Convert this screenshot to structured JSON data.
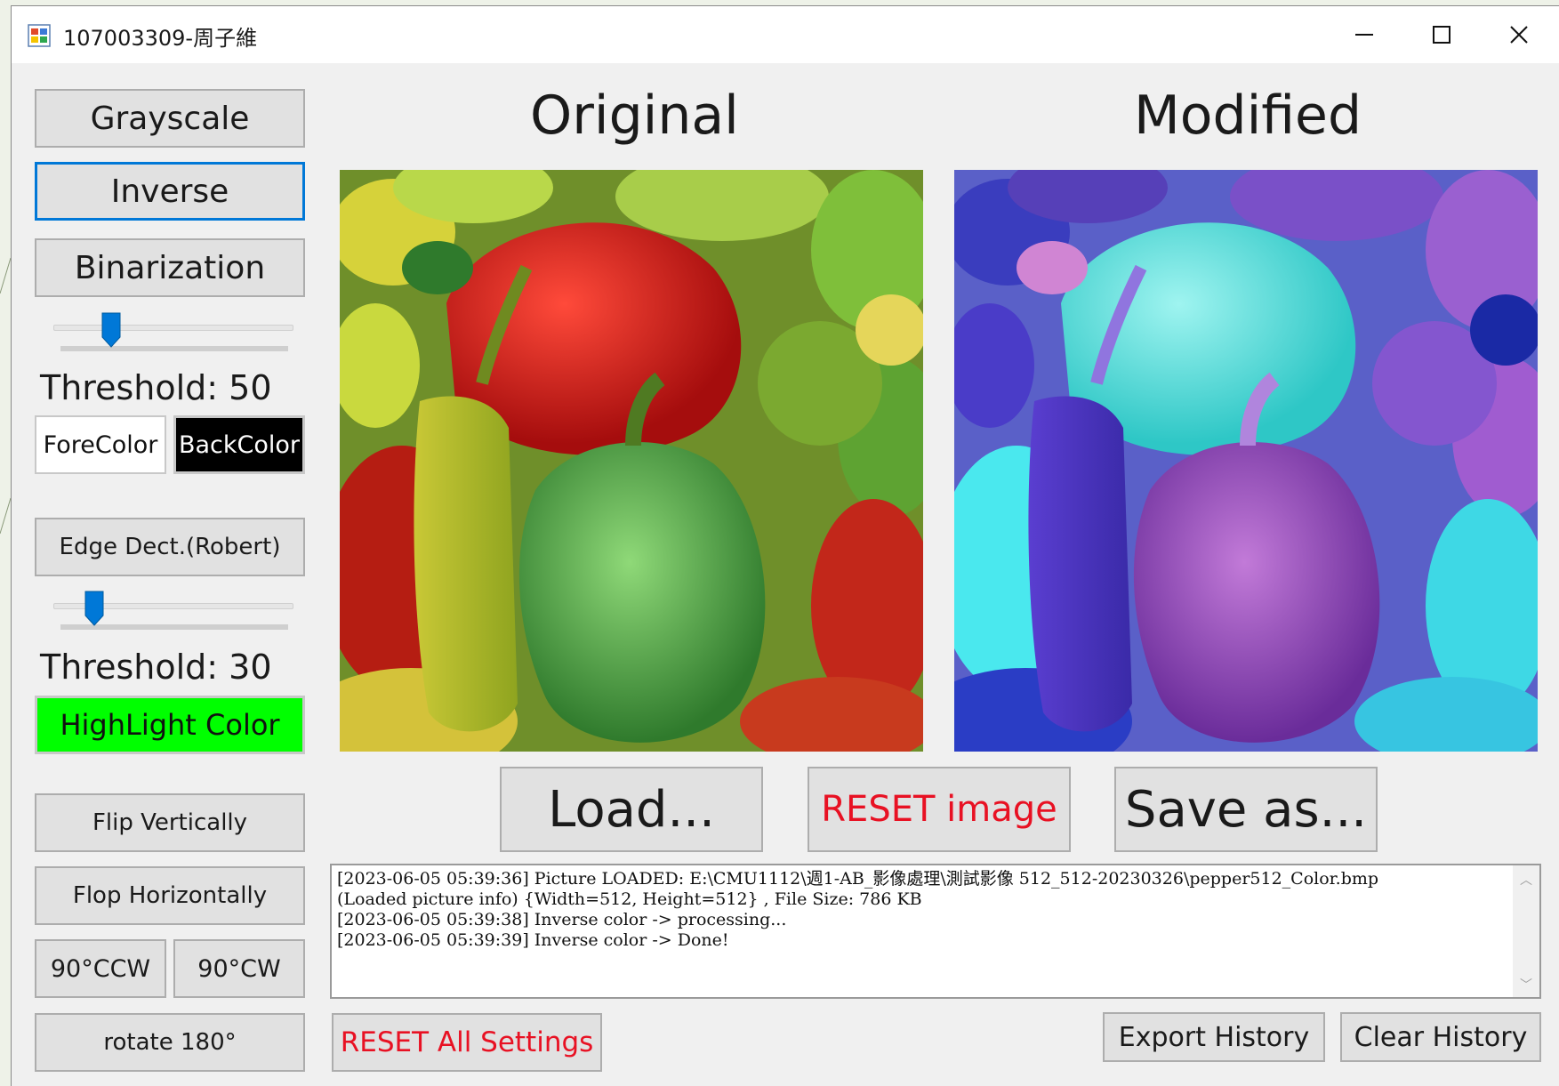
{
  "window": {
    "title": "107003309-周子維"
  },
  "controls": {
    "minimize": "minimize",
    "maximize": "maximize",
    "close": "close"
  },
  "toolbar": {
    "grayscale": "Grayscale",
    "inverse": "Inverse",
    "binarization": "Binarization",
    "binarization_threshold_label": "Threshold: 50",
    "binarization_threshold_value": 50,
    "forecolor": "ForeColor",
    "backcolor": "BackColor",
    "edge_detect": "Edge Dect.(Robert)",
    "edge_threshold_label": "Threshold: 30",
    "edge_threshold_value": 30,
    "highlight_color": "HighLight Color",
    "flip_vertically": "Flip Vertically",
    "flop_horizontally": "Flop Horizontally",
    "rotate_ccw": "90°CCW",
    "rotate_cw": "90°CW",
    "rotate_180": "rotate 180°"
  },
  "colors": {
    "forecolor": "#ffffff",
    "backcolor": "#000000",
    "highlight": "#00ff00",
    "reset_text": "#e81123",
    "focus_border": "#0078d7"
  },
  "images": {
    "original_title": "Original",
    "modified_title": "Modified"
  },
  "actions": {
    "load": "Load...",
    "reset_image": "RESET image",
    "save_as": "Save as...",
    "reset_all": "RESET All Settings",
    "export_history": "Export History",
    "clear_history": "Clear History"
  },
  "history": {
    "lines": [
      "[2023-06-05 05:39:36] Picture LOADED: E:\\CMU1112\\週1-AB_影像處理\\測試影像 512_512-20230326\\pepper512_Color.bmp",
      "(Loaded picture info) {Width=512, Height=512} , File Size: 786 KB",
      "[2023-06-05 05:39:38] Inverse color -> processing...",
      "[2023-06-05 05:39:39] Inverse color -> Done!"
    ]
  }
}
